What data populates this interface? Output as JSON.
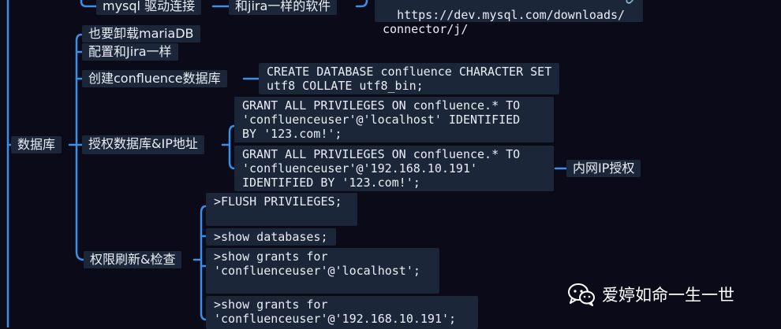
{
  "nodes": {
    "mysql_driver": "mysql 驱动连接",
    "like_jira_software": "和jira一样的软件",
    "connector_url": "https://dev.mysql.com/downloads/\nconnector/j/",
    "uninstall_mariadb": "也要卸载mariaDB",
    "config_like_jira": "配置和Jira一样",
    "create_db": "创建confluence数据库",
    "create_db_sql": "CREATE DATABASE confluence CHARACTER SET\nutf8 COLLATE utf8_bin;",
    "database": "数据库",
    "grant_db_ip": "授权数据库&IP地址",
    "grant_localhost_sql": "GRANT ALL PRIVILEGES ON confluence.* TO\n'confluenceuser'@'localhost' IDENTIFIED\nBY '123.com!';",
    "grant_lan_sql": "GRANT ALL PRIVILEGES ON confluence.* TO\n'confluenceuser'@'192.168.10.191'\nIDENTIFIED BY '123.com!';",
    "lan_ip_grant": "内网IP授权",
    "refresh_check": "权限刷新&检查",
    "flush_privileges": ">FLUSH PRIVILEGES;\n ",
    "show_databases": ">show databases;",
    "show_grants_localhost": ">show grants for\n'confluenceuser'@'localhost';\n ",
    "show_grants_lan": ">show grants for\n'confluenceuser'@'192.168.10.191';"
  },
  "icons": {
    "link": "link-icon",
    "watermark": "wechat-icon"
  },
  "watermark": {
    "text": "爱婷如命一生一世"
  },
  "colors": {
    "background": "#0b0a18",
    "node": "#1b2638",
    "connector": "#3d8fe6",
    "text": "#e9eef6"
  }
}
